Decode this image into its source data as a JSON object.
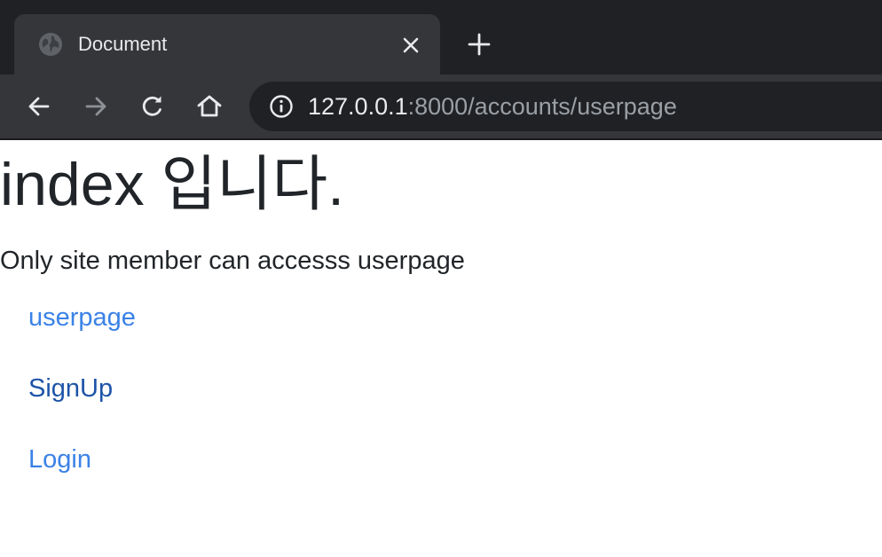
{
  "browser": {
    "tab": {
      "title": "Document",
      "favicon": "globe-icon",
      "close": "close-icon"
    },
    "new_tab": "plus-icon",
    "toolbar": {
      "back": "back-arrow-icon",
      "forward": "forward-arrow-icon",
      "reload": "reload-icon",
      "home": "home-icon"
    },
    "address": {
      "info": "info-icon",
      "host": "127.0.0.1",
      "rest": ":8000/accounts/userpage"
    },
    "colors": {
      "tabstrip": "#202124",
      "tab_active": "#35363a",
      "omnibox": "#202124"
    }
  },
  "page": {
    "title": "index 입니다.",
    "notice": "Only site member can accesss userpage",
    "links": [
      {
        "label": "userpage",
        "color": "#3b82e6"
      },
      {
        "label": "SignUp",
        "color": "#1e54a8"
      },
      {
        "label": "Login",
        "color": "#3b82e6"
      }
    ]
  }
}
